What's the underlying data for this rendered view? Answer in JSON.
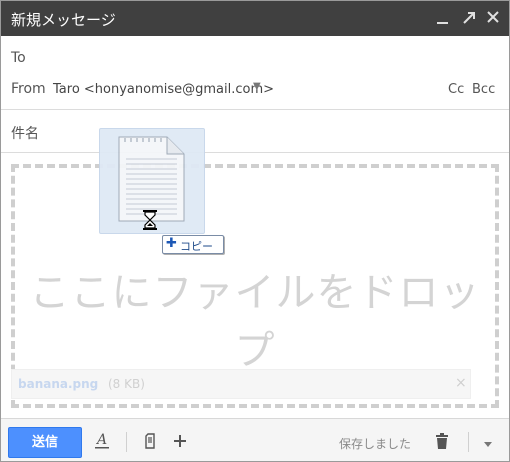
{
  "window": {
    "title": "新規メッセージ",
    "controls": [
      "minimize-icon",
      "popout-icon",
      "close-icon"
    ]
  },
  "compose": {
    "to_label": "To",
    "from_label": "From",
    "from_value": "Taro <honyanomise@gmail.com>",
    "cc_label": "Cc",
    "bcc_label": "Bcc",
    "subject_label": "件名"
  },
  "dropzone": {
    "text": "ここにファイルをドロップ"
  },
  "attachment": {
    "filename": "banana.png",
    "size": "(8 KB)",
    "remove": "×"
  },
  "drag": {
    "copy_label": "コピー"
  },
  "footer": {
    "send_label": "送信",
    "saved_status": "保存しました"
  },
  "colors": {
    "titlebar": "#404040",
    "send_button": "#4d90fe",
    "drop_text": "#d4d4d4"
  }
}
